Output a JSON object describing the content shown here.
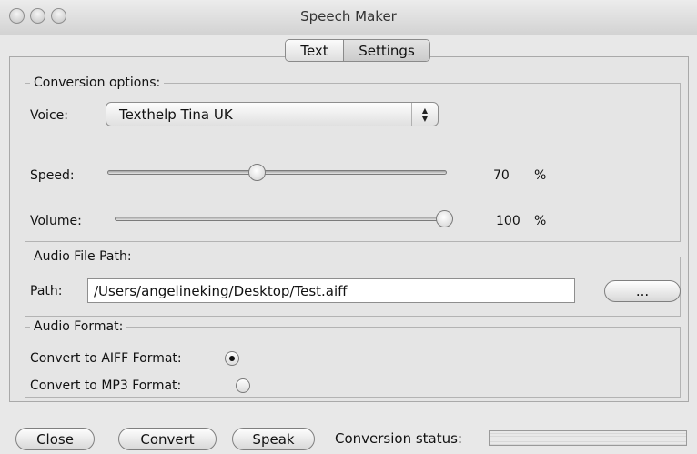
{
  "window": {
    "title": "Speech Maker"
  },
  "tabs": [
    {
      "label": "Text",
      "selected": true
    },
    {
      "label": "Settings",
      "selected": false
    }
  ],
  "conversion_options": {
    "group_label": "Conversion options:",
    "voice_label": "Voice:",
    "voice_value": "Texthelp Tina UK",
    "speed_label": "Speed:",
    "speed_value": "70",
    "speed_unit": "%",
    "speed_level": 0.7,
    "volume_label": "Volume:",
    "volume_value": "100",
    "volume_unit": "%",
    "volume_level": 1.0
  },
  "audio_file_path": {
    "group_label": "Audio File Path:",
    "path_label": "Path:",
    "path_value": "/Users/angelineking/Desktop/Test.aiff",
    "browse_label": "..."
  },
  "audio_format": {
    "group_label": "Audio Format:",
    "options": [
      {
        "label": "Convert to AIFF Format:",
        "selected": true
      },
      {
        "label": "Convert to MP3 Format:",
        "selected": false
      }
    ]
  },
  "footer": {
    "close_label": "Close",
    "convert_label": "Convert",
    "speak_label": "Speak",
    "status_label": "Conversion status:"
  }
}
